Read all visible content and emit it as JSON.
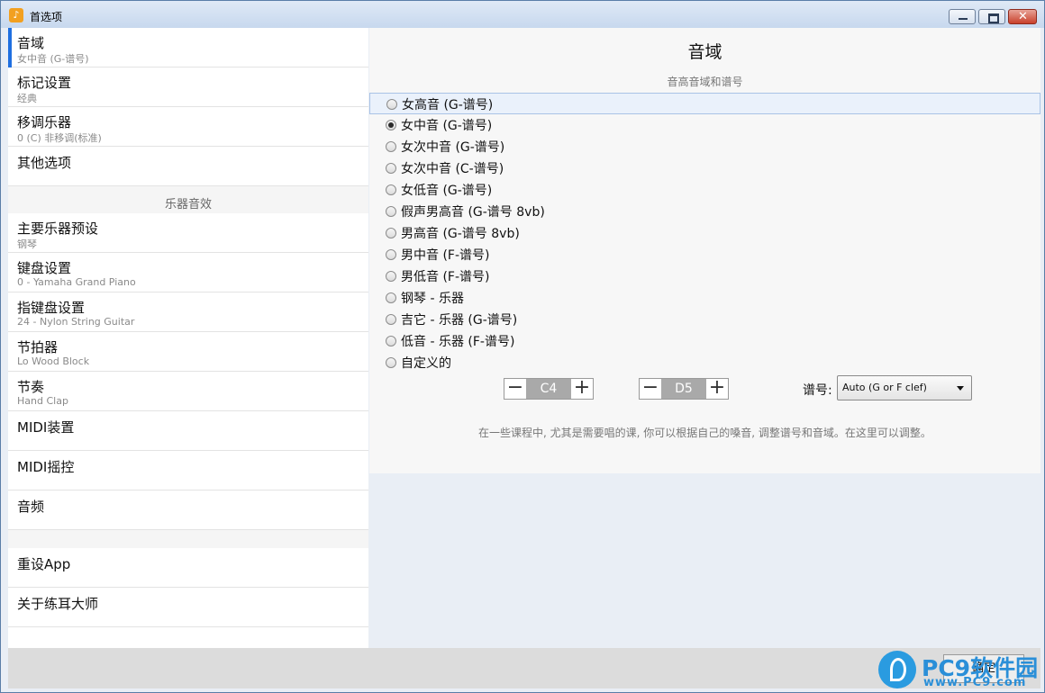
{
  "window": {
    "title": "首选项"
  },
  "sidebar": {
    "items": [
      {
        "label": "音域",
        "sub": "女中音 (G-谱号)"
      },
      {
        "label": "标记设置",
        "sub": "经典"
      },
      {
        "label": "移调乐器",
        "sub": "0 (C) 非移调(标准)"
      },
      {
        "label": "其他选项",
        "sub": ""
      },
      {
        "label": "主要乐器预设",
        "sub": "钢琴"
      },
      {
        "label": "键盘设置",
        "sub": "0 - Yamaha Grand Piano"
      },
      {
        "label": "指键盘设置",
        "sub": "24 - Nylon String Guitar"
      },
      {
        "label": "节拍器",
        "sub": "Lo Wood Block"
      },
      {
        "label": "节奏",
        "sub": "Hand Clap"
      },
      {
        "label": "MIDI装置",
        "sub": ""
      },
      {
        "label": "MIDI摇控",
        "sub": ""
      },
      {
        "label": "音频",
        "sub": ""
      },
      {
        "label": "重设App",
        "sub": ""
      },
      {
        "label": "关于练耳大师",
        "sub": ""
      }
    ],
    "section_header": "乐器音效"
  },
  "main": {
    "title": "音域",
    "subtitle": "音高音域和谱号",
    "options": [
      {
        "label": "女高音 (G-谱号)"
      },
      {
        "label": "女中音 (G-谱号)"
      },
      {
        "label": "女次中音 (G-谱号)"
      },
      {
        "label": "女次中音 (C-谱号)"
      },
      {
        "label": "女低音 (G-谱号)"
      },
      {
        "label": "假声男高音 (G-谱号 8vb)"
      },
      {
        "label": "男高音 (G-谱号 8vb)"
      },
      {
        "label": "男中音 (F-谱号)"
      },
      {
        "label": "男低音 (F-谱号)"
      },
      {
        "label": "钢琴 - 乐器"
      },
      {
        "label": "吉它 - 乐器 (G-谱号)"
      },
      {
        "label": "低音 - 乐器 (F-谱号)"
      },
      {
        "label": "自定义的"
      }
    ],
    "selected_option": "女中音 (G-谱号)",
    "low_note": "C4",
    "high_note": "D5",
    "clef_label": "谱号:",
    "clef_value": "Auto (G or F clef)",
    "hint": "在一些课程中, 尤其是需要唱的课, 你可以根据自己的嗓音, 调整谱号和音域。在这里可以调整。"
  },
  "footer": {
    "ok_label": "确定"
  },
  "watermark": {
    "brand": "PC9软件园",
    "url": "www.PC9.com"
  },
  "colors": {
    "accent": "#1f6fe0",
    "title_bar": "#c7d8ee",
    "close_button": "#c9402b"
  }
}
